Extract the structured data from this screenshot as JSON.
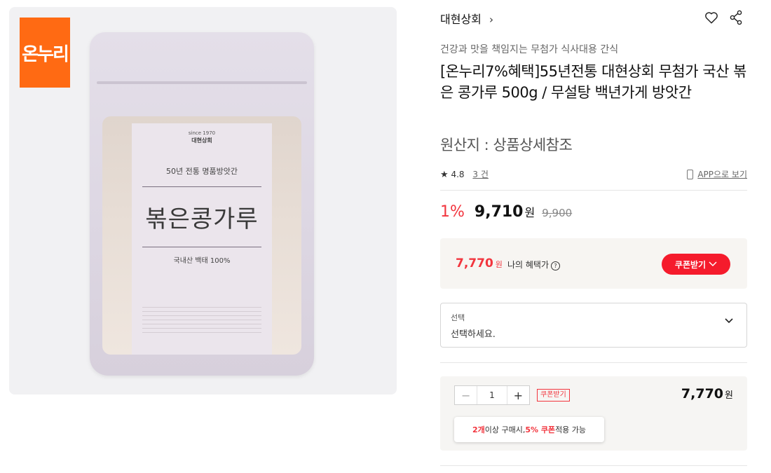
{
  "badge": {
    "text": "온누리"
  },
  "product_image": {
    "since": "since 1970",
    "brand": "대현상회",
    "sub": "50년 전통 명품방앗간",
    "name": "볶은콩가루",
    "origin": "국내산 백태 100%"
  },
  "store": {
    "name": "대현상회",
    "chevron": "›"
  },
  "tagline": "건강과 맛을 책임지는 무첨가 식사대용 간식",
  "title": "[온누리7%혜택]55년전통 대현상회 무첨가 국산 볶은 콩가루 500g / 무설탕 백년가게 방앗간",
  "origin_line": "원산지 : 상품상세참조",
  "rating": {
    "star": "★",
    "score": "4.8",
    "count": "3 건"
  },
  "app_link": "APP으로 보기",
  "price": {
    "discount": "1%",
    "sale": "9,710",
    "won": "원",
    "original": "9,900"
  },
  "benefit": {
    "price": "7,770",
    "won": "원",
    "label": "나의 혜택가",
    "help": "?",
    "coupon_button": "쿠폰받기"
  },
  "select": {
    "label": "선택",
    "value": "선택하세요."
  },
  "order": {
    "minus": "−",
    "qty": "1",
    "plus": "+",
    "coupon_mini": "쿠폰받기",
    "total": "7,770",
    "won": "원",
    "tooltip": {
      "count": "2개",
      "text1": " 이상 구매시, ",
      "percent": "5% 쿠폰",
      "text2": " 적용 가능"
    }
  },
  "colors": {
    "accent_red": "#f2353e",
    "badge_orange": "#ff6a13"
  }
}
